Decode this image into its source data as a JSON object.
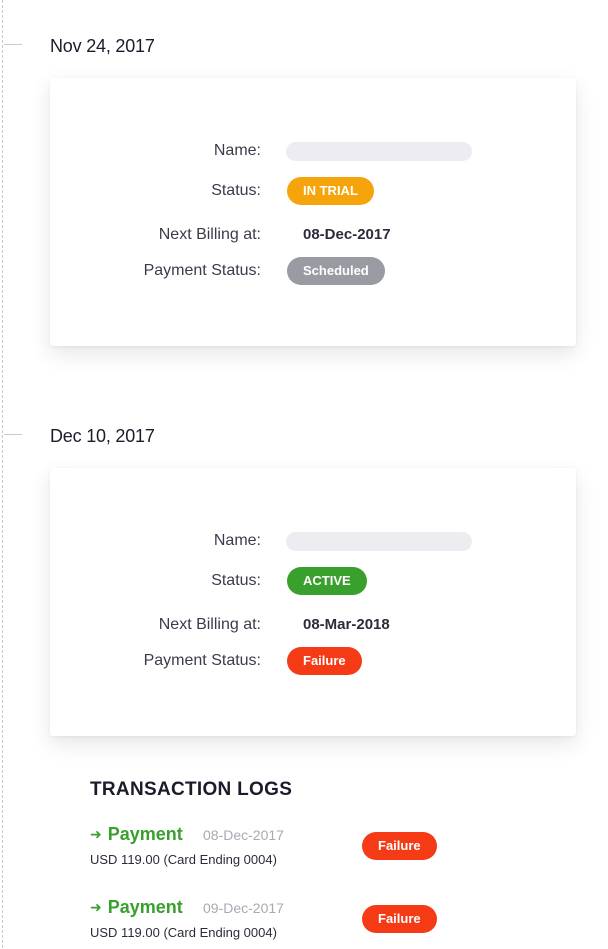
{
  "colors": {
    "trial": "#f5a50b",
    "active": "#3aa02d",
    "scheduled": "#9a9aa3",
    "failure": "#f53b16",
    "payment_text": "#3aa02d"
  },
  "labels": {
    "name": "Name:",
    "status": "Status:",
    "next_billing": "Next Billing at:",
    "payment_status": "Payment Status:"
  },
  "entries": [
    {
      "date": "Nov 24, 2017",
      "status": "IN TRIAL",
      "next_billing": "08-Dec-2017",
      "payment_status": "Scheduled"
    },
    {
      "date": "Dec 10, 2017",
      "status": "ACTIVE",
      "next_billing": "08-Mar-2018",
      "payment_status": "Failure"
    }
  ],
  "transaction_logs": {
    "title": "TRANSACTION LOGS",
    "items": [
      {
        "type": "Payment",
        "date": "08-Dec-2017",
        "detail": "USD 119.00 (Card Ending 0004)",
        "status": "Failure"
      },
      {
        "type": "Payment",
        "date": "09-Dec-2017",
        "detail": "USD 119.00 (Card Ending 0004)",
        "status": "Failure"
      }
    ]
  }
}
